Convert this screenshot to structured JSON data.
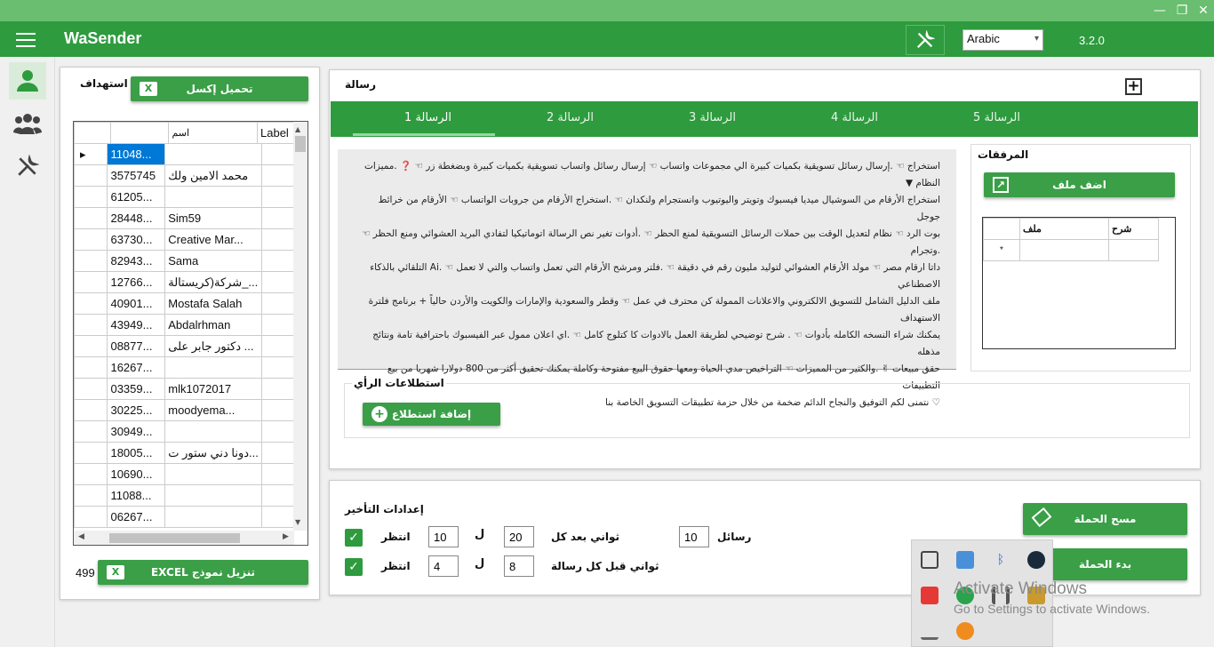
{
  "app": {
    "title": "WaSender",
    "version": "3.2.0",
    "language": "Arabic"
  },
  "window_controls": {
    "minimize": "—",
    "maximize": "❐",
    "close": "✕"
  },
  "left_panel": {
    "target_label": "استهداف",
    "upload_excel_label": "تحميل إكسل",
    "columns": [
      "اسم",
      "Label"
    ],
    "rows": [
      {
        "number": "11048...",
        "name": ""
      },
      {
        "number": "3575745",
        "name": "محمد الامين ولك"
      },
      {
        "number": "61205...",
        "name": ""
      },
      {
        "number": "28448...",
        "name": "Sim59"
      },
      {
        "number": "63730...",
        "name": "Creative Mar..."
      },
      {
        "number": "82943...",
        "name": "Sama"
      },
      {
        "number": "12766...",
        "name": "شركة(كريستالة_..."
      },
      {
        "number": "40901...",
        "name": "Mostafa Salah"
      },
      {
        "number": "43949...",
        "name": "Abdalrhman"
      },
      {
        "number": "08877...",
        "name": "دكتور جابر على ..."
      },
      {
        "number": "16267...",
        "name": ""
      },
      {
        "number": "03359...",
        "name": "mlk1072017"
      },
      {
        "number": "30225...",
        "name": "moodyema..."
      },
      {
        "number": "30949...",
        "name": ""
      },
      {
        "number": "18005...",
        "name": "دونا دني ستور ت..."
      },
      {
        "number": "10690...",
        "name": ""
      },
      {
        "number": "11088...",
        "name": ""
      },
      {
        "number": "06267...",
        "name": ""
      }
    ],
    "count": "499",
    "download_template_label": "EXCEL تنزيل نموذج"
  },
  "message_panel": {
    "header_label": "رسالة",
    "tabs": [
      "الرسالة 1",
      "الرسالة 2",
      "الرسالة 3",
      "الرسالة 4",
      "الرسالة 5"
    ],
    "text_lines": [
      "استخراج ☜ .إرسال رسائل تسويقية بكميات كبيرة الي مجموعات واتساب ☜ إرسال رسائل واتساب تسويقية بكميات كبيرة وبضغطة زر ☜ ❓ .مميزات النظام ▼",
      "استخراج الأرقام من السوشيال ميديا فيسبوك وتويتر واليوتيوب وانستجرام ولنكدان ☜ .استخراج الأرقام من جروبات الواتساب ☜ الأرقام من خرائط جوجل",
      "بوت الرد ☜ نظام لتعديل الوقت بين حملات الرسائل التسويقية لمنع الحظر ☜ .أدوات تغير نص الرسالة اتوماتيكيا لتفادي البريد العشوائي ومنع الحظر ☜ .وتجرام",
      "داتا ارقام مصر ☜ مولد الأرقام العشوائي لتوليد مليون رقم في دقيقة ☜ .فلتر ومرشح الأرقام التي تعمل واتساب والتي لا تعمل ☜ .Ai التلقائي بالذكاء الاصطناعي",
      "ملف الدليل الشامل للتسويق الالكتروني والاعلانات الممولة كن محترف في عمل ☜ وقطر والسعودية والإمارات والكويت والأردن حالياً + برنامج فلترة الاستهداف",
      "يمكنك شراء النسخه الكامله بأدوات ☜ . شرح توضيحي لطريقة العمل بالادوات كا كتلوج كامل ☜ .اي اعلان ممول عبر الفيسبوك باحترافية تامة ونتائج مذهله",
      "حقق مبيعات ✌ .والكثير من المميزات ☜ التراخيص مدي الحياة ومعها حقوق البيع مفتوحة وكاملة يمكنك تحقيق أكثر من 800 دولارا شهريا من بيع التطبيقات",
      "♡ نتمنى لكم التوفيق والنجاح الدائم ضخمة من خلال حزمة تطبيقات التسويق الخاصة بنا"
    ],
    "attachments_label": "المرفقات",
    "add_file_label": "اضف ملف",
    "attach_columns": [
      "ملف",
      "شرح"
    ],
    "polls_label": "استطلاعات الرأي",
    "add_poll_label": "إضافة استطلاع"
  },
  "delay_panel": {
    "title": "إعدادات التأخير",
    "row1": {
      "wait_label": "انتظر",
      "min": "10",
      "to_label": "ل",
      "max": "20",
      "unit_label": "ثواني بعد كل",
      "count": "10",
      "count_label": "رسائل"
    },
    "row2": {
      "wait_label": "انتظر",
      "min": "4",
      "to_label": "ل",
      "max": "8",
      "unit_label": "ثواني قبل كل رسالة"
    },
    "clear_campaign_label": "مسح الحملة",
    "start_campaign_label": "بدء الحملة"
  },
  "watermark": {
    "title": "Activate Windows",
    "subtitle": "Go to Settings to activate Windows."
  },
  "colors": {
    "primary": "#2e9b3e",
    "titlebar": "#6abe6f",
    "tab_bar": "#2e9b3e"
  }
}
